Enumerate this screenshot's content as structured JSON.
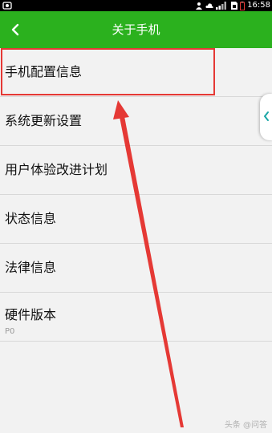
{
  "status_bar": {
    "time": "16:58"
  },
  "header": {
    "title": "关于手机"
  },
  "items": [
    {
      "label": "手机配置信息"
    },
    {
      "label": "系统更新设置"
    },
    {
      "label": "用户体验改进计划"
    },
    {
      "label": "状态信息"
    },
    {
      "label": "法律信息"
    },
    {
      "label": "硬件版本",
      "sub": "P0"
    }
  ],
  "watermark": "头条 @问答",
  "colors": {
    "header": "#2bb11e",
    "highlight": "#e53935",
    "arrow": "#e53935"
  }
}
